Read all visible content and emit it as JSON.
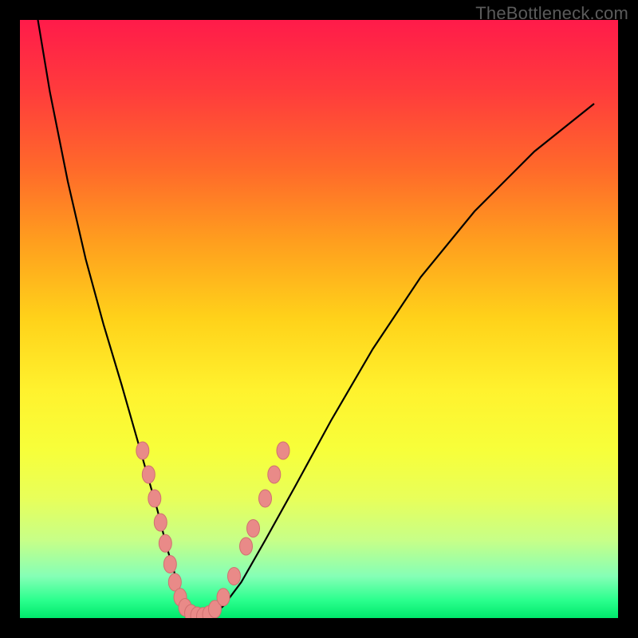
{
  "watermark": "TheBottleneck.com",
  "colors": {
    "frame": "#000000",
    "marker_fill": "#e98a88",
    "marker_stroke": "#d07070",
    "curve": "#000000"
  },
  "chart_data": {
    "type": "line",
    "title": "",
    "xlabel": "",
    "ylabel": "",
    "xlim": [
      0,
      100
    ],
    "ylim": [
      0,
      100
    ],
    "grid": false,
    "legend": false,
    "annotations": [
      {
        "text": "TheBottleneck.com",
        "position": "top-right"
      }
    ],
    "series": [
      {
        "name": "bottleneck-curve",
        "x": [
          3,
          5,
          8,
          11,
          14,
          17,
          19,
          21,
          23,
          24.5,
          26,
          27.3,
          28.7,
          30,
          32,
          34,
          37,
          41,
          46,
          52,
          59,
          67,
          76,
          86,
          96
        ],
        "y": [
          100,
          88,
          73,
          60,
          49,
          39,
          32,
          25,
          18,
          12,
          7,
          3,
          1,
          0,
          0.5,
          2,
          6,
          13,
          22,
          33,
          45,
          57,
          68,
          78,
          86
        ]
      }
    ],
    "markers": {
      "name": "highlighted-points",
      "points": [
        {
          "x": 20.5,
          "y": 28
        },
        {
          "x": 21.5,
          "y": 24
        },
        {
          "x": 22.5,
          "y": 20
        },
        {
          "x": 23.5,
          "y": 16
        },
        {
          "x": 24.3,
          "y": 12.5
        },
        {
          "x": 25.1,
          "y": 9
        },
        {
          "x": 25.9,
          "y": 6
        },
        {
          "x": 26.8,
          "y": 3.5
        },
        {
          "x": 27.6,
          "y": 1.8
        },
        {
          "x": 28.6,
          "y": 0.8
        },
        {
          "x": 29.6,
          "y": 0.4
        },
        {
          "x": 30.6,
          "y": 0.3
        },
        {
          "x": 31.6,
          "y": 0.6
        },
        {
          "x": 32.6,
          "y": 1.5
        },
        {
          "x": 34.0,
          "y": 3.5
        },
        {
          "x": 35.8,
          "y": 7
        },
        {
          "x": 37.8,
          "y": 12
        },
        {
          "x": 39.0,
          "y": 15
        },
        {
          "x": 41.0,
          "y": 20
        },
        {
          "x": 42.5,
          "y": 24
        },
        {
          "x": 44.0,
          "y": 28
        }
      ]
    }
  }
}
